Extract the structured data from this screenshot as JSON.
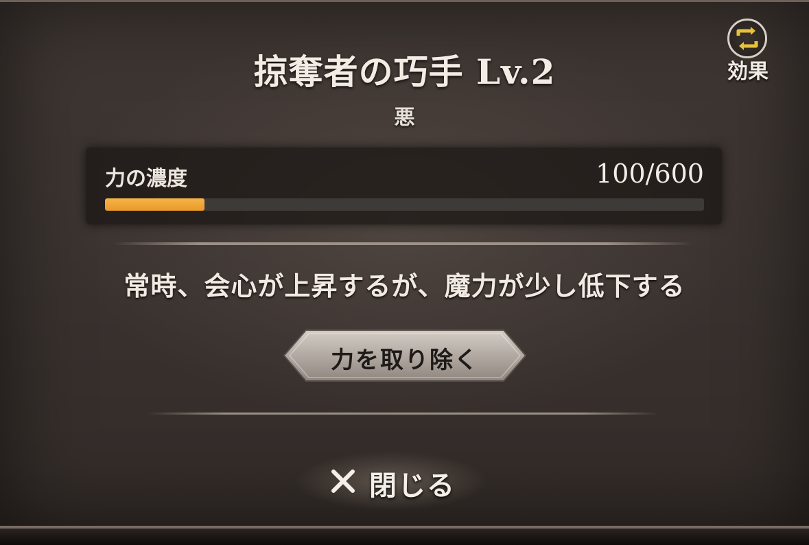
{
  "dialog": {
    "title": "掠奪者の巧手 Lv.2",
    "alignment": "悪",
    "effect_toggle": {
      "icon": "swap-arrows-icon",
      "label": "効果"
    },
    "gauge": {
      "label": "力の濃度",
      "value_text": "100/600",
      "current": 100,
      "max": 600,
      "fill_color": "#f2a93b"
    },
    "description": "常時、会心が上昇するが、魔力が少し低下する",
    "remove_button": {
      "label": "力を取り除く"
    },
    "close_button": {
      "icon": "close-icon",
      "label": "閉じる"
    }
  }
}
